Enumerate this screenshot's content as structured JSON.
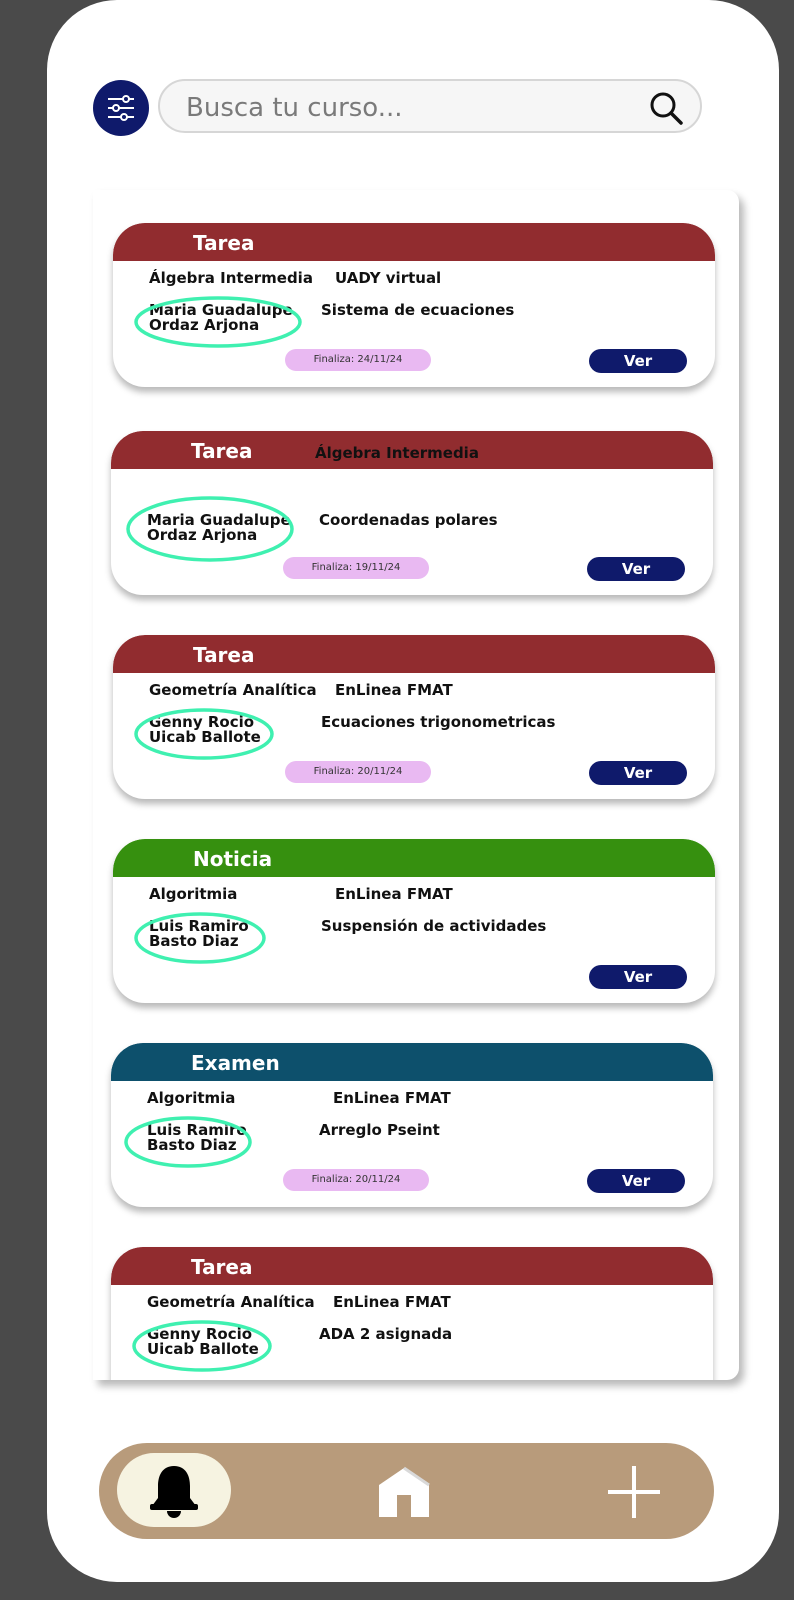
{
  "search": {
    "placeholder": "Busca tu curso..."
  },
  "icons": {
    "menu": "sliders-icon",
    "search": "search-icon",
    "highlight": "circle-highlight",
    "bell": "bell-icon",
    "home": "home-icon",
    "add": "plus-icon"
  },
  "colors": {
    "tarea": "#912c2f",
    "noticia": "#36900f",
    "examen": "#0d506c",
    "accent": "#0f1a6b",
    "deadline": "#e9b9f2",
    "highlight": "#3ff0b0",
    "nav": "#b89b7b"
  },
  "cards": [
    {
      "type": "Tarea",
      "subject": "Álgebra Intermedia",
      "platform": "UADY virtual",
      "author_line1": "Maria Guadalupe",
      "author_line2": "Ordaz Arjona",
      "title": "Sistema de ecuaciones",
      "deadline": "Finaliza: 24/11/24",
      "button": "Ver"
    },
    {
      "type": "Tarea",
      "header_extra": "Álgebra Intermedia",
      "author_line1": "Maria Guadalupe",
      "author_line2": "Ordaz Arjona",
      "title": "Coordenadas polares",
      "deadline": "Finaliza: 19/11/24",
      "button": "Ver"
    },
    {
      "type": "Tarea",
      "subject": "Geometría Analítica",
      "platform": "EnLinea FMAT",
      "author_line1": "Genny Rocio",
      "author_line2": "Uicab Ballote",
      "title": "Ecuaciones trigonometricas",
      "deadline": "Finaliza: 20/11/24",
      "button": "Ver"
    },
    {
      "type": "Noticia",
      "subject": "Algoritmia",
      "platform": "EnLinea FMAT",
      "author_line1": "Luis Ramiro",
      "author_line2": "Basto Diaz",
      "title": "Suspensión de actividades",
      "button": "Ver"
    },
    {
      "type": "Examen",
      "subject": "Algoritmia",
      "platform": "EnLinea FMAT",
      "author_line1": "Luis Ramiro",
      "author_line2": "Basto Diaz",
      "title": "Arreglo Pseint",
      "deadline": "Finaliza: 20/11/24",
      "button": "Ver"
    },
    {
      "type": "Tarea",
      "subject": "Geometría Analítica",
      "platform": "EnLinea FMAT",
      "author_line1": "Genny Rocio",
      "author_line2": "Uicab Ballote",
      "title": "ADA 2 asignada"
    }
  ]
}
